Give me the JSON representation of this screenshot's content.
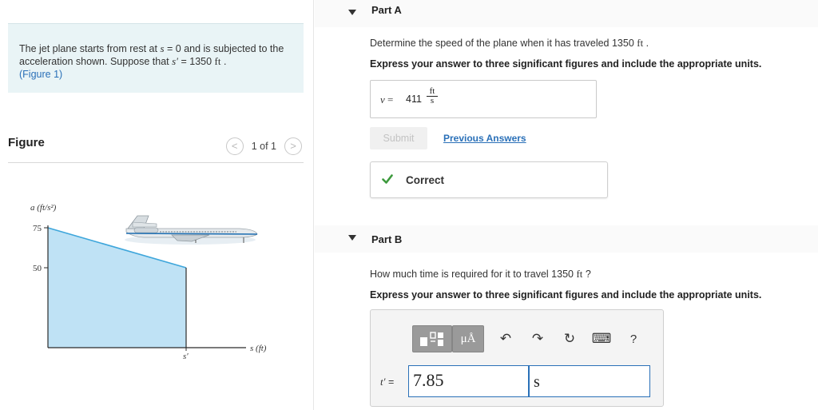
{
  "problem": {
    "text_before": "The jet plane starts from rest at ",
    "s_symbol": "s",
    "equals_zero": " = 0 and is subjected to the acceleration shown. Suppose that ",
    "s_prime": "s′",
    "equals_value": " = 1350 ",
    "unit": "ft",
    "period": " .",
    "figure_link": "(Figure 1)"
  },
  "figure_panel": {
    "title": "Figure",
    "pager_text": "1 of 1",
    "prev_glyph": "<",
    "next_glyph": ">"
  },
  "chart_data": {
    "type": "area",
    "xlabel": "s (ft)",
    "ylabel": "a (ft/s²)",
    "x_tick_labels": [
      "s′"
    ],
    "y_tick_labels": [
      "75",
      "50"
    ],
    "x": [
      0,
      1
    ],
    "values": [
      75,
      50
    ],
    "ylim": [
      0,
      90
    ],
    "fill_color": "#bfe2f5",
    "line_color": "#3ea6db"
  },
  "part_a": {
    "title": "Part A",
    "question_prefix": "Determine the speed of the plane when it has traveled 1350 ",
    "question_unit": "ft",
    "question_suffix": " .",
    "instruction": "Express your answer to three significant figures and include the appropriate units.",
    "answer_var": "v",
    "answer_eq": " = ",
    "answer_value": "411",
    "answer_unit_num": "ft",
    "answer_unit_den": "s",
    "submit_label": "Submit",
    "previous_answers_label": "Previous Answers",
    "feedback": "Correct"
  },
  "part_b": {
    "title": "Part B",
    "question_prefix": "How much time is required for it to travel 1350 ",
    "question_unit": "ft",
    "question_suffix": " ?",
    "instruction": "Express your answer to three significant figures and include the appropriate units.",
    "toolbar": {
      "templates_icon": "templates-icon",
      "units_label": "μÅ",
      "undo_glyph": "↶",
      "redo_glyph": "↷",
      "reset_glyph": "↻",
      "keyboard_glyph": "⌨",
      "help_glyph": "?"
    },
    "answer_var": "t′",
    "answer_eq": " =",
    "value_input": "7.85",
    "units_input": "s"
  },
  "colors": {
    "link": "#2a70b8",
    "problem_bg": "#e9f4f6",
    "check_green": "#3d9a3d"
  }
}
